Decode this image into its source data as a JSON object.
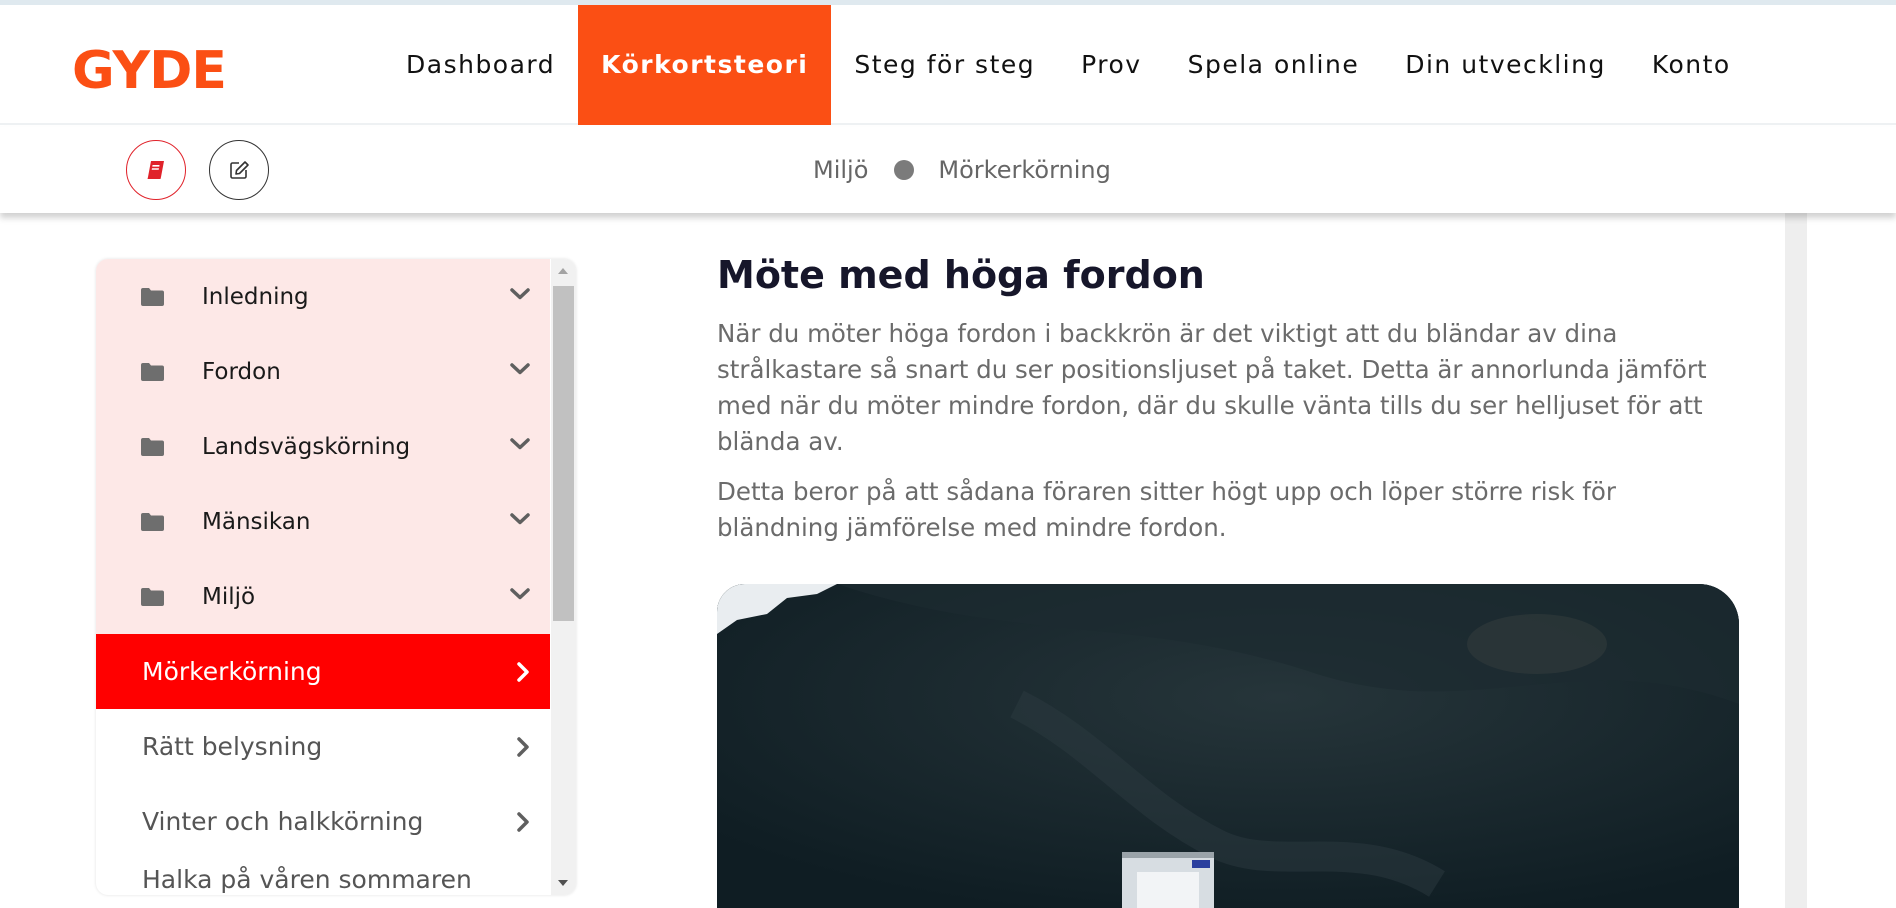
{
  "brand": {
    "logo": "GYDE",
    "accent": "#fb4f14"
  },
  "nav": {
    "items": [
      {
        "label": "Dashboard"
      },
      {
        "label": "Körkortsteori",
        "active": true
      },
      {
        "label": "Steg för steg"
      },
      {
        "label": "Prov"
      },
      {
        "label": "Spela online"
      },
      {
        "label": "Din utveckling"
      },
      {
        "label": "Konto"
      }
    ]
  },
  "toolbar": {
    "book_icon": "book-icon",
    "edit_icon": "edit-icon"
  },
  "breadcrumb": {
    "parent": "Miljö",
    "current": "Mörkerkörning"
  },
  "sidebar": {
    "categories": [
      {
        "label": "Inledning"
      },
      {
        "label": "Fordon"
      },
      {
        "label": "Landsvägskörning"
      },
      {
        "label": "Mänsikan"
      },
      {
        "label": "Miljö"
      }
    ],
    "lessons": [
      {
        "label": "Mörkerkörning",
        "active": true
      },
      {
        "label": "Rätt belysning"
      },
      {
        "label": "Vinter och halkkörning"
      },
      {
        "label": "Halka på våren sommaren"
      }
    ]
  },
  "article": {
    "title": "Möte med höga fordon",
    "paragraphs": [
      "När du möter höga fordon i backkrön är det viktigt att du bländar av dina strålkastare så snart du ser positionsljuset på taket. Detta är annorlunda jämfört med när du möter mindre fordon, där du skulle vänta tills du ser helljuset för att blända av.",
      "Detta beror på att sådana föraren sitter högt upp och löper större risk för bländning jämförelse med mindre fordon."
    ]
  },
  "colors": {
    "active_lesson": "#ff0000",
    "category_bg": "#fde8e7",
    "book_icon": "#e0222a"
  }
}
